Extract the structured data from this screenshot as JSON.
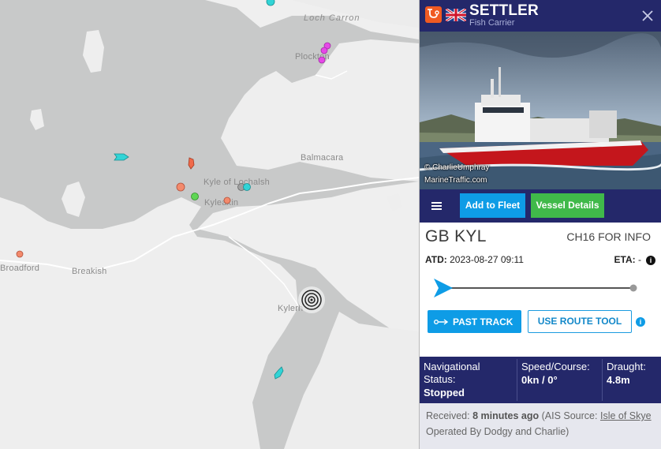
{
  "map": {
    "labels": {
      "loch_carron": "Loch Carron",
      "plockton": "Plockton",
      "balmacara": "Balmacara",
      "kyle_of_lochalsh": "Kyle of Lochalsh",
      "kyleakin": "Kyleakin",
      "broadford": "Broadford",
      "breakish": "Breakish",
      "kylerhea": "Kylerh"
    },
    "colors": {
      "water": "#c8c9c9",
      "land": "#eeeeee"
    }
  },
  "vessel": {
    "name": "SETTLER",
    "type": "Fish Carrier",
    "flag_icon": "uk-flag-icon",
    "type_icon": "fish-carrier-icon"
  },
  "photo": {
    "credit_line1": "© CharlieUmphray",
    "credit_line2": "MarineTraffic.com"
  },
  "actions": {
    "menu_icon": "hamburger-menu-icon",
    "add_to_fleet": "Add to Fleet",
    "vessel_details": "Vessel Details"
  },
  "voyage": {
    "destination_country": "GB",
    "destination_port": "KYL",
    "ch16": "CH16 FOR INFO",
    "atd_label": "ATD:",
    "atd_value": "2023-08-27 09:11",
    "eta_label": "ETA:",
    "eta_value": "-",
    "past_track": "PAST TRACK",
    "route_tool": "USE ROUTE TOOL"
  },
  "status": {
    "nav_label": "Navigational Status:",
    "nav_value": "Stopped",
    "speed_label": "Speed/Course:",
    "speed_value": "0kn / 0°",
    "draught_label": "Draught:",
    "draught_value": "4.8m"
  },
  "received": {
    "prefix": "Received:",
    "time": "8 minutes ago",
    "source_prefix": "(AIS Source:",
    "source_link": "Isle of Skye",
    "source_suffix": "Operated By Dodgy and Charlie)"
  },
  "colors": {
    "header_navy": "#24286a",
    "accent_blue": "#0e9ce6",
    "accent_green": "#40b94a",
    "badge_orange": "#f05a22"
  }
}
